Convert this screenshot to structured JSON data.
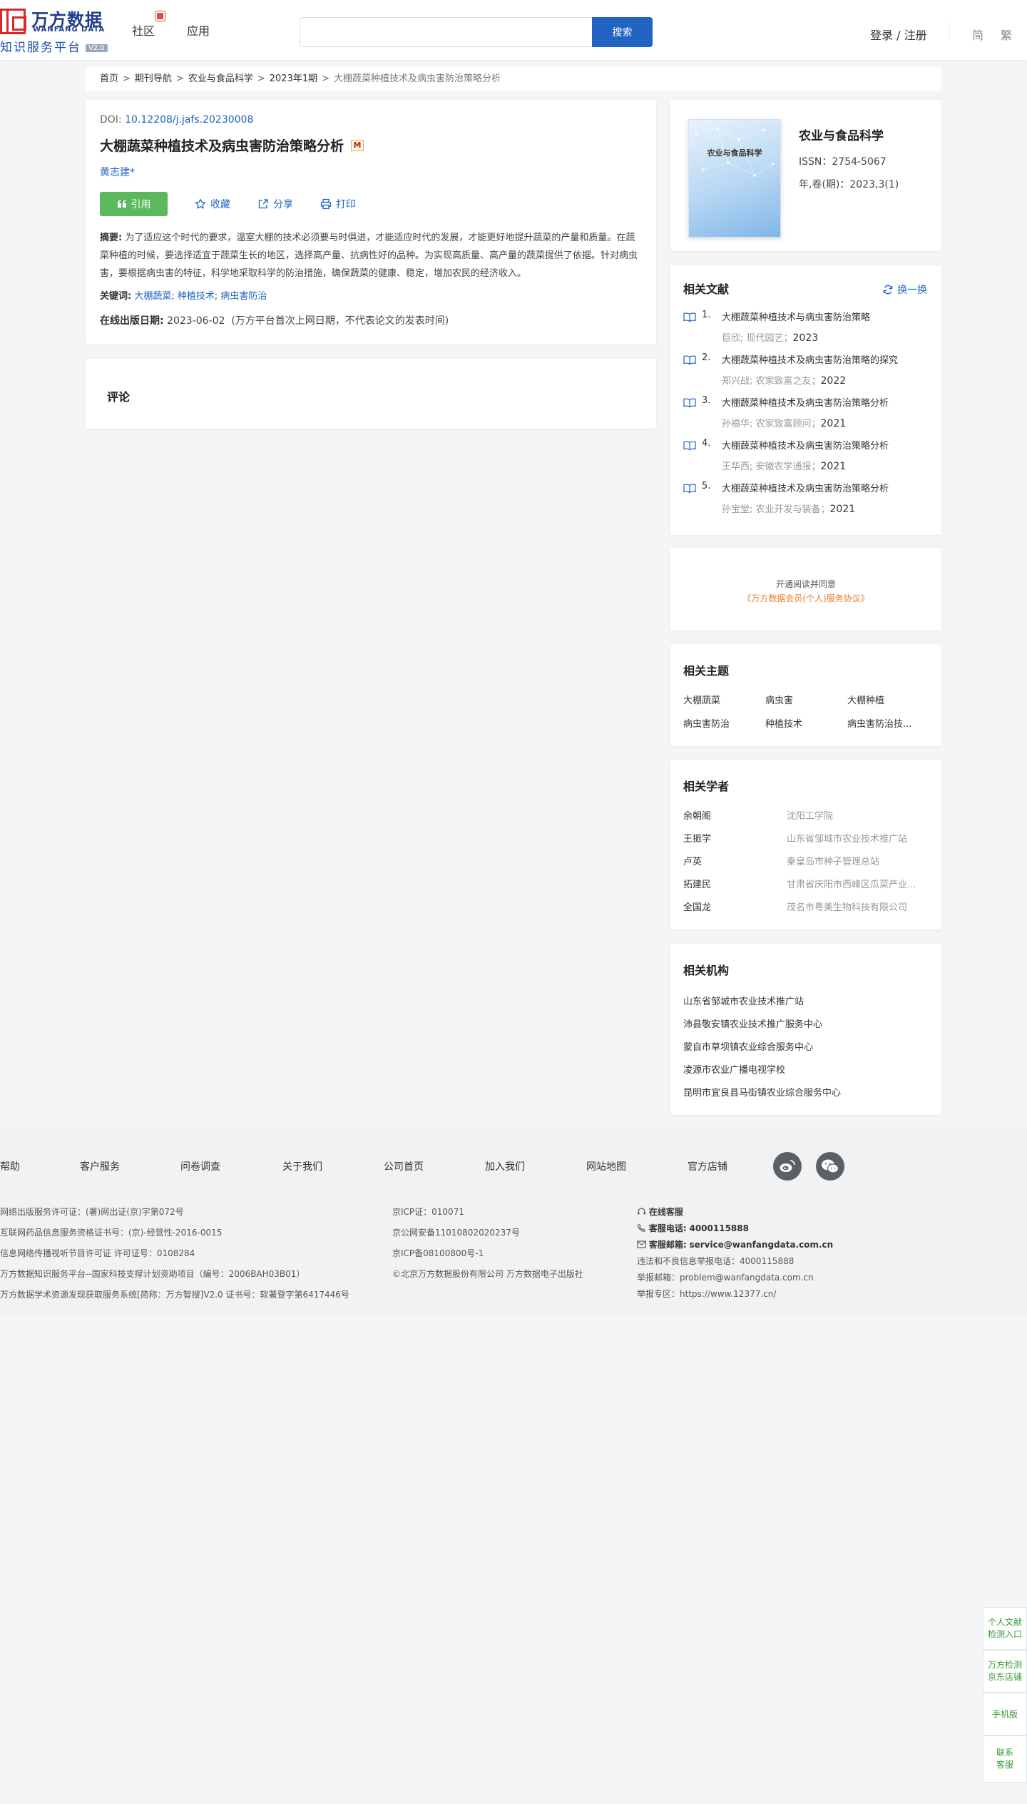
{
  "header": {
    "logo_cn": "万方数据",
    "logo_en": "WANFANG DATA",
    "logo_sub": "知识服务平台",
    "logo_version": "V2.0",
    "nav": [
      "社区",
      "应用"
    ],
    "search_placeholder": "",
    "search_button": "搜索",
    "login": "登录 / 注册",
    "lang_simplified": "简",
    "lang_traditional": "繁"
  },
  "breadcrumb": [
    "首页",
    "期刊导航",
    "农业与食品科学",
    "2023年1期",
    "大棚蔬菜种植技术及病虫害防治策略分析"
  ],
  "article": {
    "doi_label": "DOI:",
    "doi": "10.12208/j.jafs.20230008",
    "title": "大棚蔬菜种植技术及病虫害防治策略分析",
    "m_badge": "M",
    "author": "黄志建*",
    "actions": {
      "cite": "引用",
      "favorite": "收藏",
      "share": "分享",
      "print": "打印"
    },
    "abstract_label": "摘要:",
    "abstract": "为了适应这个时代的要求，温室大棚的技术必须要与时俱进，才能适应时代的发展，才能更好地提升蔬菜的产量和质量。在蔬菜种植的时候，要选择适宜于蔬菜生长的地区，选择高产量、抗病性好的品种。为实现高质量、高产量的蔬菜提供了依据。针对病虫害，要根据病虫害的特征，科学地采取科学的防治措施，确保蔬菜的健康、稳定，增加农民的经济收入。",
    "keywords_label": "关键词:",
    "keywords": [
      "大棚蔬菜",
      "种植技术",
      "病虫害防治"
    ],
    "pubdate_label": "在线出版日期:",
    "pubdate": "2023-06-02",
    "pubdate_note": "(万方平台首次上网日期，不代表论文的发表时间)"
  },
  "comment": {
    "title": "评论"
  },
  "journal": {
    "cover_title": "农业与食品科学",
    "name": "农业与食品科学",
    "issn": "ISSN：2754-5067",
    "volume": "年,卷(期)：2023,3(1)"
  },
  "related_refs": {
    "title": "相关文献",
    "refresh": "换一换",
    "items": [
      {
        "num": "1.",
        "title": "大棚蔬菜种植技术与病虫害防治策略",
        "author": "巨欣; 现代园艺；",
        "year": "2023"
      },
      {
        "num": "2.",
        "title": "大棚蔬菜种植技术及病虫害防治策略的探究",
        "author": "郑兴战; 农家致富之友；",
        "year": "2022"
      },
      {
        "num": "3.",
        "title": "大棚蔬菜种植技术及病虫害防治策略分析",
        "author": "孙福华; 农家致富顾问；",
        "year": "2021"
      },
      {
        "num": "4.",
        "title": "大棚蔬菜种植技术及病虫害防治策略分析",
        "author": "王华西; 安徽农学通报；",
        "year": "2021"
      },
      {
        "num": "5.",
        "title": "大棚蔬菜种植技术及病虫害防治策略分析",
        "author": "孙宝堂; 农业开发与装备；",
        "year": "2021"
      }
    ]
  },
  "agreement": {
    "line1": "开通阅读并同意",
    "line2": "《万方数据会员(个人)服务协议》"
  },
  "topics": {
    "title": "相关主题",
    "items": [
      "大棚蔬菜",
      "病虫害",
      "大棚种植",
      "病虫害防治",
      "种植技术",
      "病虫害防治技..."
    ]
  },
  "scholars": {
    "title": "相关学者",
    "items": [
      {
        "name": "余朝阁",
        "org": "沈阳工学院"
      },
      {
        "name": "王振学",
        "org": "山东省邹城市农业技术推广站"
      },
      {
        "name": "卢英",
        "org": "秦皇岛市种子管理总站"
      },
      {
        "name": "拓建民",
        "org": "甘肃省庆阳市西峰区瓜菜产业..."
      },
      {
        "name": "全国龙",
        "org": "茂名市粤美生物科技有限公司"
      }
    ]
  },
  "orgs": {
    "title": "相关机构",
    "items": [
      "山东省邹城市农业技术推广站",
      "沛县敬安镇农业技术推广服务中心",
      "蒙自市草坝镇农业综合服务中心",
      "凌源市农业广播电视学校",
      "昆明市宜良县马街镇农业综合服务中心"
    ]
  },
  "footer": {
    "links": [
      "帮助",
      "客户服务",
      "问卷调查",
      "关于我们",
      "公司首页",
      "加入我们",
      "网站地图",
      "官方店铺"
    ],
    "col1": [
      "网络出版服务许可证：(署)网出证(京)字第072号",
      "互联网药品信息服务资格证书号：(京)-经营性-2016-0015",
      "信息网络传播视听节目许可证 许可证号：0108284",
      "万方数据知识服务平台--国家科技支撑计划资助项目（编号：2006BAH03B01）",
      "万方数据学术资源发现获取服务系统[简称：万方智搜]V2.0 证书号：软著登字第6417446号"
    ],
    "col2": [
      "京ICP证：010071",
      "京公网安备11010802020237号",
      "京ICP备08100800号-1",
      "©北京万方数据股份有限公司 万方数据电子出版社"
    ],
    "online_service": "在线客服",
    "phone_label": "客服电话:",
    "phone": "4000115888",
    "email_label": "客服邮箱:",
    "email": "service@wanfangdata.com.cn",
    "report_phone": "违法和不良信息举报电话：4000115888",
    "report_email": "举报邮箱：problem@wanfangdata.com.cn",
    "report_site": "举报专区：https://www.12377.cn/"
  },
  "side_widgets": [
    "个人文献检测入口",
    "万方检测京东店铺",
    "手机版",
    "联系客服"
  ],
  "colors": {
    "primary": "#2163c0",
    "cite_green": "#5cb85c",
    "agreement_orange": "#e87d2a"
  }
}
